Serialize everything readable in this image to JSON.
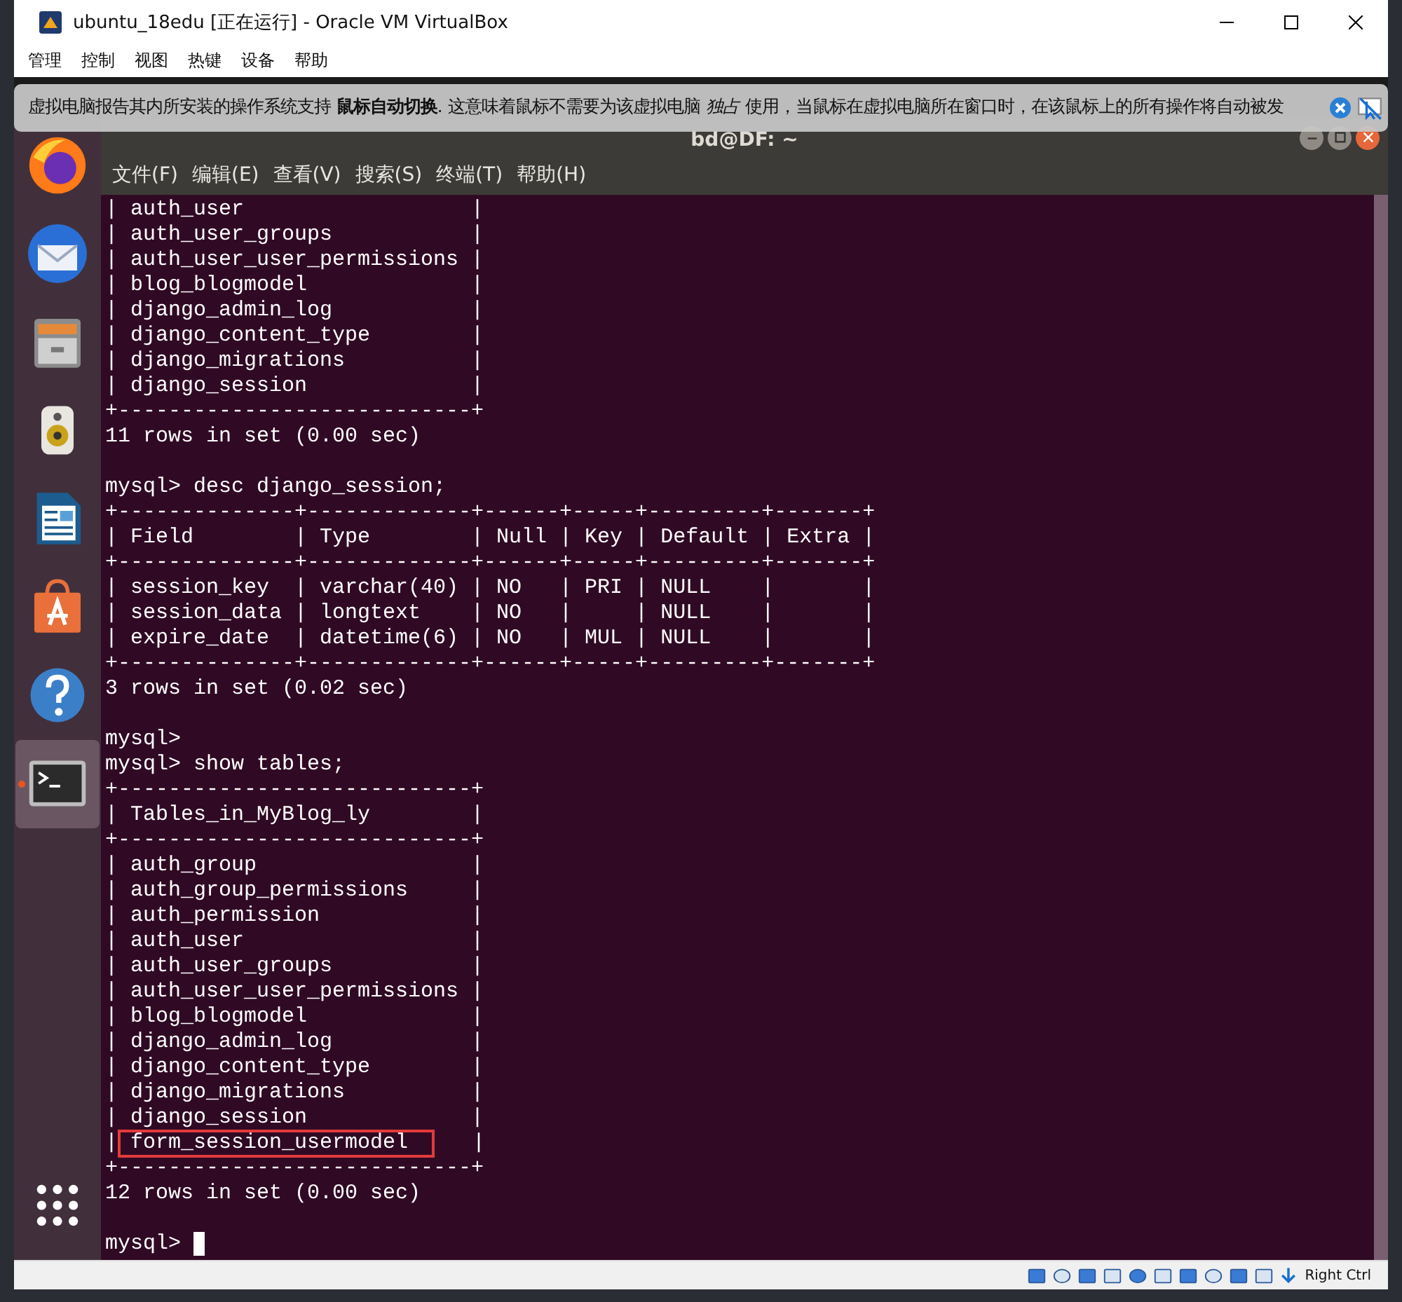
{
  "window": {
    "title": "ubuntu_18edu [正在运行] - Oracle VM VirtualBox"
  },
  "menu": [
    "管理",
    "控制",
    "视图",
    "热键",
    "设备",
    "帮助"
  ],
  "notification": {
    "text": "虚拟电脑报告其内所安装的操作系统支持 **鼠标自动切换**. 这意味着鼠标不需要为该虚拟电脑 *独占* 使用，当鼠标在虚拟电脑所在窗口时，在该鼠标上的所有操作将自动被发"
  },
  "dock": {
    "items": [
      {
        "kind": "browser",
        "selected": false
      },
      {
        "kind": "mail",
        "selected": false
      },
      {
        "kind": "files",
        "selected": false
      },
      {
        "kind": "music",
        "selected": false
      },
      {
        "kind": "writer",
        "selected": false
      },
      {
        "kind": "store",
        "selected": false
      },
      {
        "kind": "help",
        "selected": false
      },
      {
        "kind": "terminal",
        "selected": true
      },
      {
        "kind": "apps",
        "selected": false
      }
    ]
  },
  "terminal": {
    "title": "bd@DF: ~",
    "menu": [
      "文件(F)",
      "编辑(E)",
      "查看(V)",
      "搜索(S)",
      "终端(T)",
      "帮助(H)"
    ],
    "lines": [
      {
        "kind": "text",
        "text": "| auth_user                  |"
      },
      {
        "kind": "text",
        "text": "| auth_user_groups           |"
      },
      {
        "kind": "text",
        "text": "| auth_user_user_permissions |"
      },
      {
        "kind": "text",
        "text": "| blog_blogmodel             |"
      },
      {
        "kind": "text",
        "text": "| django_admin_log           |"
      },
      {
        "kind": "text",
        "text": "| django_content_type        |"
      },
      {
        "kind": "text",
        "text": "| django_migrations          |"
      },
      {
        "kind": "text",
        "text": "| django_session             |"
      },
      {
        "kind": "text",
        "text": "+----------------------------+"
      },
      {
        "kind": "text",
        "text": "11 rows in set (0.00 sec)"
      },
      {
        "kind": "blank"
      },
      {
        "kind": "text",
        "text": "mysql> desc django_session;"
      },
      {
        "kind": "text",
        "text": "+--------------+-------------+------+-----+---------+-------+"
      },
      {
        "kind": "text",
        "text": "| Field        | Type        | Null | Key | Default | Extra |"
      },
      {
        "kind": "text",
        "text": "+--------------+-------------+------+-----+---------+-------+"
      },
      {
        "kind": "text",
        "text": "| session_key  | varchar(40) | NO   | PRI | NULL    |       |"
      },
      {
        "kind": "text",
        "text": "| session_data | longtext    | NO   |     | NULL    |       |"
      },
      {
        "kind": "text",
        "text": "| expire_date  | datetime(6) | NO   | MUL | NULL    |       |"
      },
      {
        "kind": "text",
        "text": "+--------------+-------------+------+-----+---------+-------+"
      },
      {
        "kind": "text",
        "text": "3 rows in set (0.02 sec)"
      },
      {
        "kind": "blank"
      },
      {
        "kind": "text",
        "text": "mysql>"
      },
      {
        "kind": "text",
        "text": "mysql> show tables;"
      },
      {
        "kind": "text",
        "text": "+----------------------------+"
      },
      {
        "kind": "text",
        "text": "| Tables_in_MyBlog_ly        |"
      },
      {
        "kind": "text",
        "text": "+----------------------------+"
      },
      {
        "kind": "text",
        "text": "| auth_group                 |"
      },
      {
        "kind": "text",
        "text": "| auth_group_permissions     |"
      },
      {
        "kind": "text",
        "text": "| auth_permission            |"
      },
      {
        "kind": "text",
        "text": "| auth_user                  |"
      },
      {
        "kind": "text",
        "text": "| auth_user_groups           |"
      },
      {
        "kind": "text",
        "text": "| auth_user_user_permissions |"
      },
      {
        "kind": "text",
        "text": "| blog_blogmodel             |"
      },
      {
        "kind": "text",
        "text": "| django_admin_log           |"
      },
      {
        "kind": "text",
        "text": "| django_content_type        |"
      },
      {
        "kind": "text",
        "text": "| django_migrations          |"
      },
      {
        "kind": "text",
        "text": "| django_session             |"
      },
      {
        "kind": "boxed",
        "before": "|",
        "text": "form_session_usermodel",
        "after": "|"
      },
      {
        "kind": "text",
        "text": "+----------------------------+"
      },
      {
        "kind": "text",
        "text": "12 rows in set (0.00 sec)"
      },
      {
        "kind": "blank"
      },
      {
        "kind": "cursor",
        "text": "mysql> "
      }
    ]
  },
  "status_bar": {
    "host_key": "Right Ctrl"
  }
}
